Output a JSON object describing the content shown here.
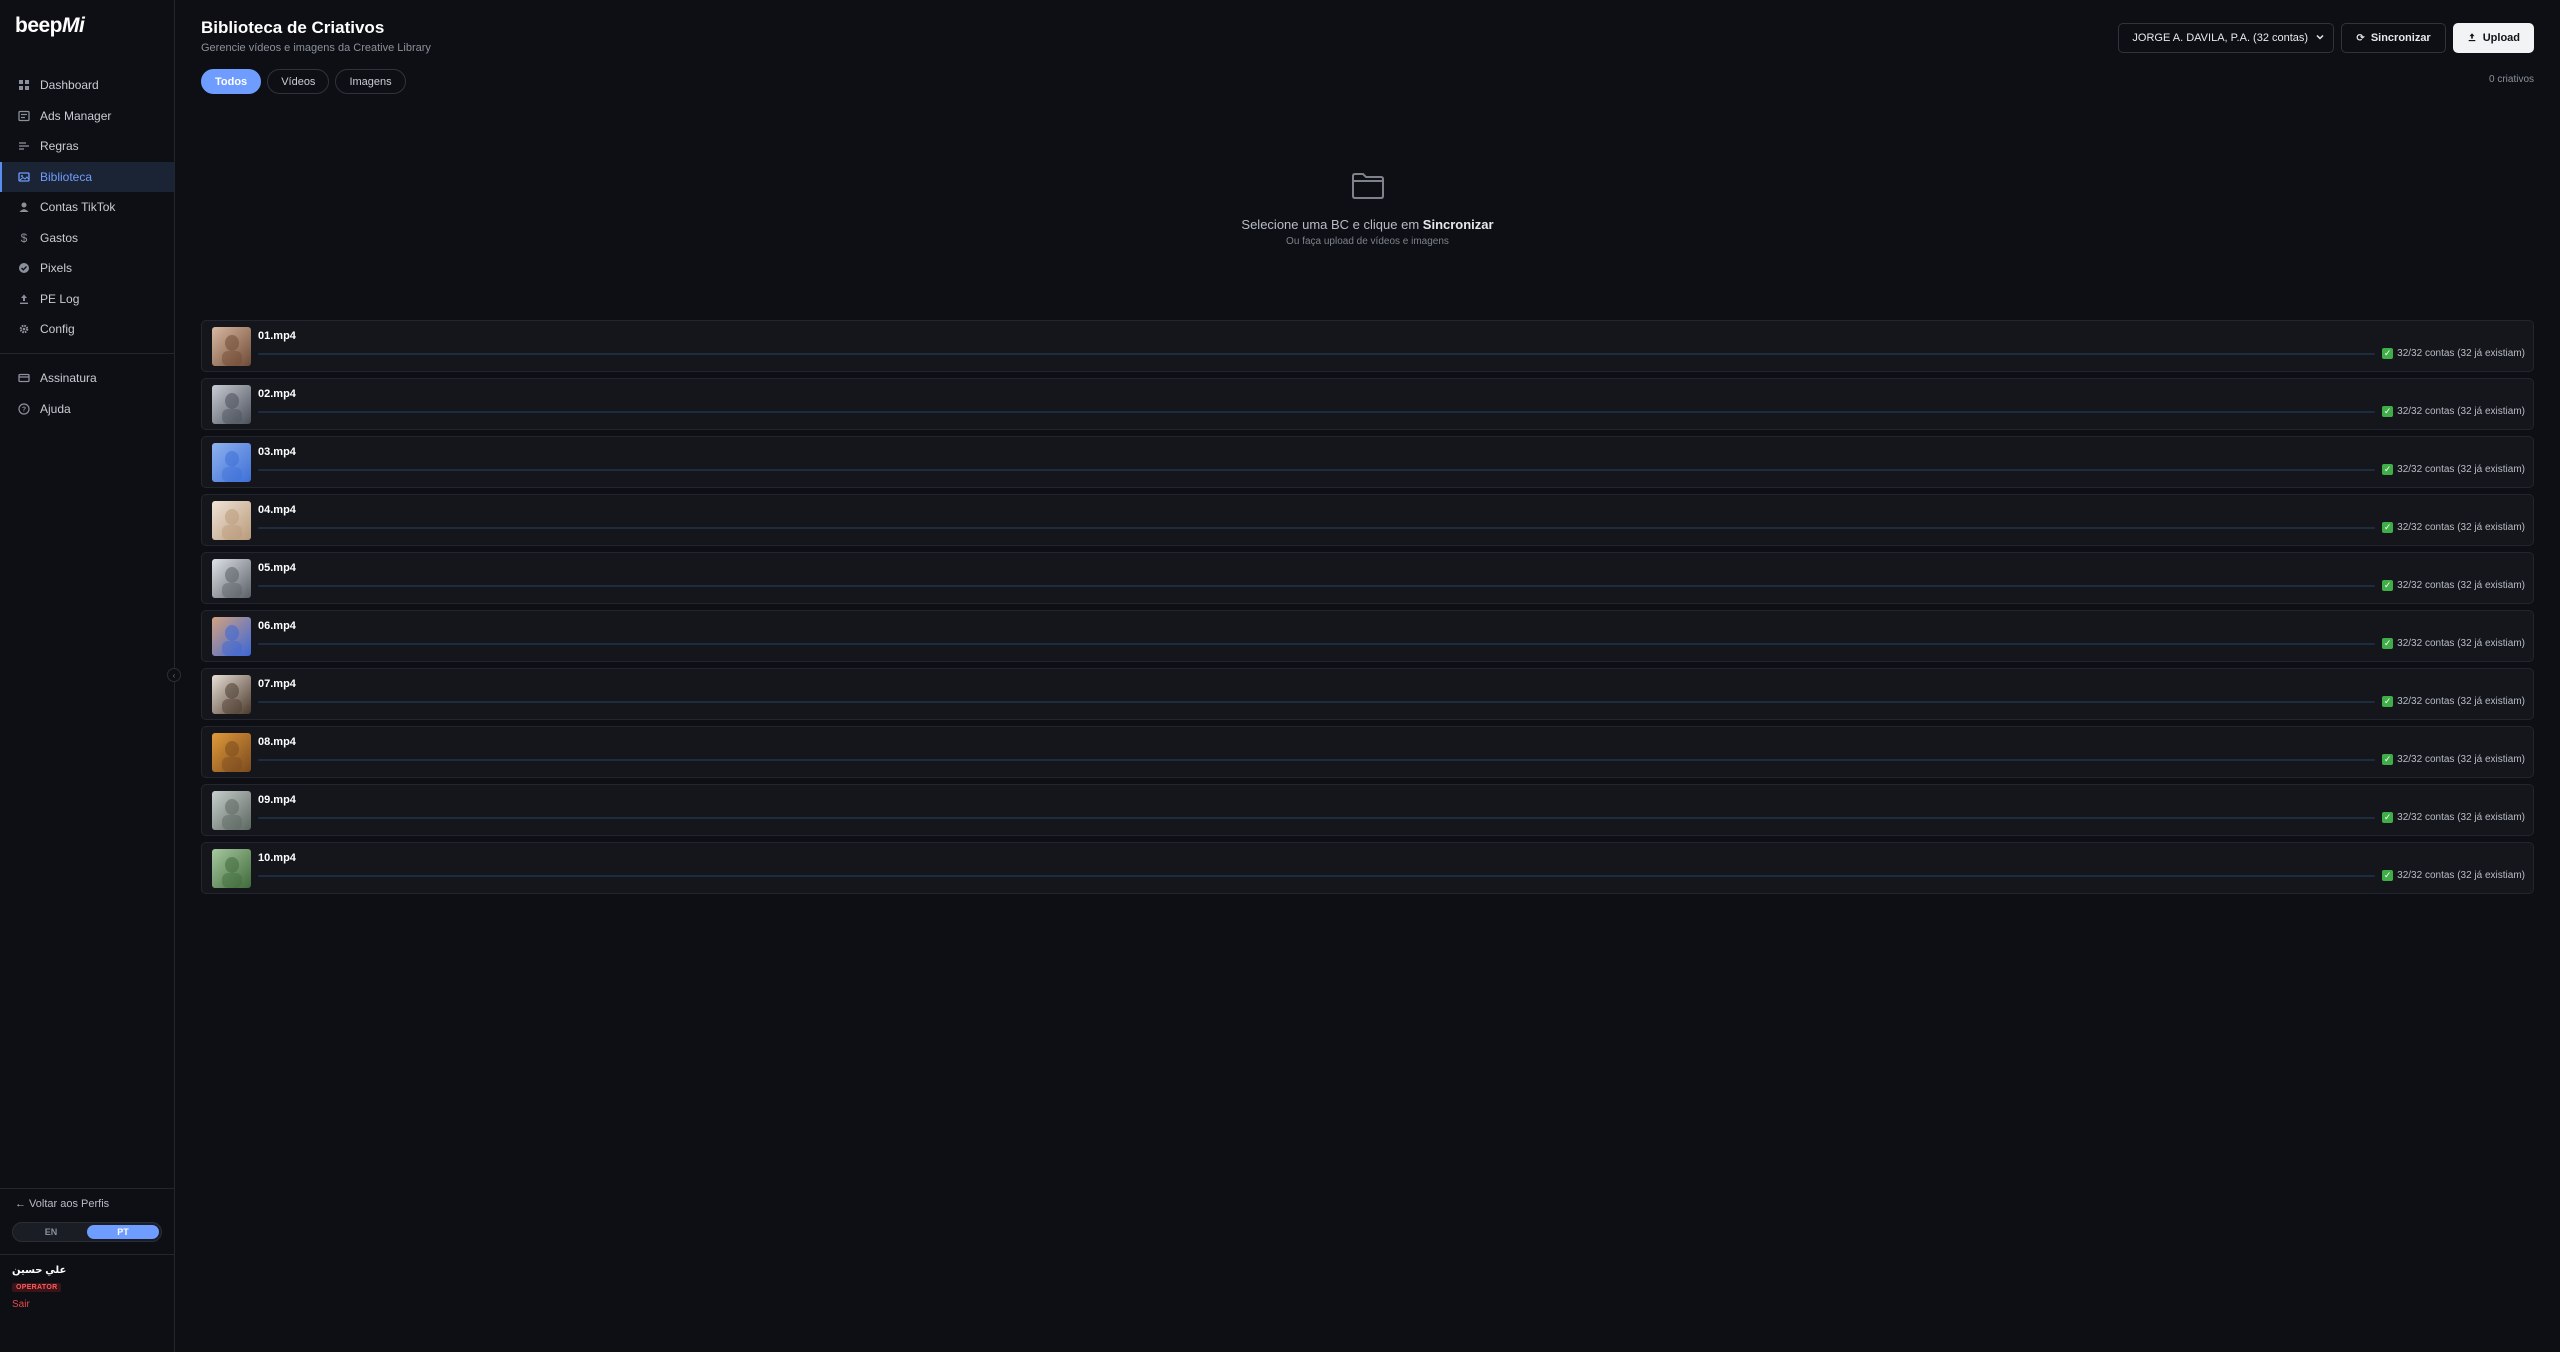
{
  "brand": {
    "logo_main": "beep",
    "logo_mi": "Mi"
  },
  "sidebar": {
    "items": [
      {
        "label": "Dashboard",
        "icon": "grid-icon"
      },
      {
        "label": "Ads Manager",
        "icon": "ads-icon"
      },
      {
        "label": "Regras",
        "icon": "rules-icon"
      },
      {
        "label": "Biblioteca",
        "icon": "library-icon",
        "active": true
      },
      {
        "label": "Contas TikTok",
        "icon": "user-icon"
      },
      {
        "label": "Gastos",
        "icon": "dollar-icon"
      },
      {
        "label": "Pixels",
        "icon": "check-circle-icon"
      },
      {
        "label": "PE Log",
        "icon": "upload-icon"
      },
      {
        "label": "Config",
        "icon": "gear-icon"
      }
    ],
    "secondary": [
      {
        "label": "Assinatura",
        "icon": "card-icon"
      },
      {
        "label": "Ajuda",
        "icon": "help-icon"
      }
    ],
    "back_link": "← Voltar aos Perfis",
    "lang": {
      "en": "EN",
      "pt": "PT",
      "active": "PT"
    },
    "user": {
      "name": "علي حسين",
      "role": "OPERATOR",
      "logout": "Sair"
    },
    "collapse_glyph": "‹"
  },
  "header": {
    "title": "Biblioteca de Criativos",
    "subtitle": "Gerencie vídeos e imagens da Creative Library",
    "account_select": "JORGE A. DAVILA, P.A. (32 contas)",
    "sync_label": "Sincronizar",
    "upload_label": "Upload"
  },
  "filters": {
    "all": "Todos",
    "videos": "Vídeos",
    "images": "Imagens",
    "active": "Todos"
  },
  "count_label": "0 criativos",
  "empty_state": {
    "icon": "folder-icon",
    "message_prefix": "Selecione uma BC e clique em ",
    "message_bold": "Sincronizar",
    "hint": "Ou faça upload de vídeos e imagens"
  },
  "uploads": [
    {
      "name": "01.mp4",
      "status": "32/32 contas (32 já existiam)",
      "progress": 1.0,
      "thumb": [
        "#6e4a35",
        "#d9b9a2"
      ]
    },
    {
      "name": "02.mp4",
      "status": "32/32 contas (32 já existiam)",
      "progress": 1.0,
      "thumb": [
        "#4a4f5a",
        "#c9ccd4"
      ]
    },
    {
      "name": "03.mp4",
      "status": "32/32 contas (32 já existiam)",
      "progress": 1.0,
      "thumb": [
        "#3d6fd6",
        "#8fb2ef"
      ]
    },
    {
      "name": "04.mp4",
      "status": "32/32 contas (32 já existiam)",
      "progress": 1.0,
      "thumb": [
        "#b99a7a",
        "#efe3d6"
      ]
    },
    {
      "name": "05.mp4",
      "status": "32/32 contas (32 já existiam)",
      "progress": 1.0,
      "thumb": [
        "#5a5f66",
        "#dfe3e8"
      ]
    },
    {
      "name": "06.mp4",
      "status": "32/32 contas (32 já existiam)",
      "progress": 1.0,
      "thumb": [
        "#3a66d8",
        "#d3a27f"
      ]
    },
    {
      "name": "07.mp4",
      "status": "32/32 contas (32 já existiam)",
      "progress": 1.0,
      "thumb": [
        "#4b3a2d",
        "#e9dfd6"
      ]
    },
    {
      "name": "08.mp4",
      "status": "32/32 contas (32 já existiam)",
      "progress": 1.0,
      "thumb": [
        "#7a4a1e",
        "#e09a3a"
      ]
    },
    {
      "name": "09.mp4",
      "status": "32/32 contas (32 já existiam)",
      "progress": 1.0,
      "thumb": [
        "#5c6660",
        "#c7cfcc"
      ]
    },
    {
      "name": "10.mp4",
      "status": "32/32 contas (32 já existiam)",
      "progress": 1.0,
      "thumb": [
        "#3f6a3a",
        "#a7c8a0"
      ]
    }
  ],
  "colors": {
    "accent": "#6f9cff",
    "success": "#3fae49",
    "danger": "#e5484d",
    "background": "#0d0f14"
  }
}
